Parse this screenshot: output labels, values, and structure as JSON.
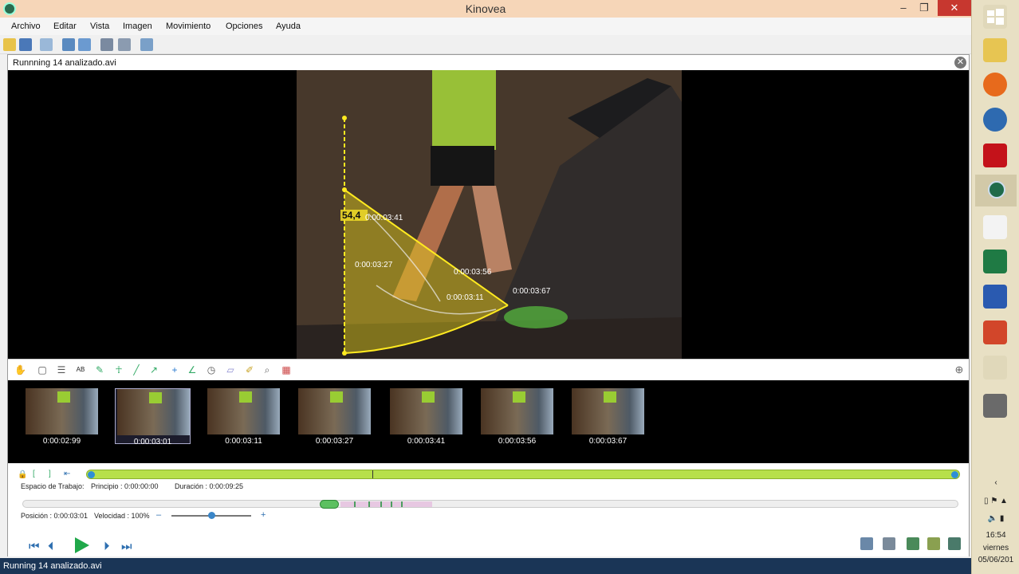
{
  "window": {
    "title": "Kinovea",
    "controls": {
      "minimize": "–",
      "maximize": "❐",
      "close": "✕"
    }
  },
  "menu": [
    "Archivo",
    "Editar",
    "Vista",
    "Imagen",
    "Movimiento",
    "Opciones",
    "Ayuda"
  ],
  "toolbar_icons": [
    "open-folder-icon",
    "save-icon",
    "layout-icon",
    "single-screen-icon",
    "dual-screen-icon",
    "capture-icon",
    "capture-dual-icon",
    "export-icon"
  ],
  "screen": {
    "title": "Runnning 14 analizado.avi",
    "close_label": "✕",
    "overlay": {
      "angle": "54,4",
      "trajectory_labels": [
        "0:00:03:41",
        "0:00:03:27",
        "0:00:03:56",
        "0:00:03:11",
        "0:00:03:67"
      ]
    }
  },
  "drawing_tools": [
    "hand-icon",
    "key-image-icon",
    "comment-icon",
    "label-icon",
    "pencil-icon",
    "human-model-icon",
    "line-icon",
    "arrow-icon",
    "cross-marker-icon",
    "angle-icon",
    "chrono-icon",
    "grid-icon",
    "magnifier-icon",
    "zoom-icon",
    "color-picker-icon"
  ],
  "thumbnails": [
    {
      "time": "0:00:02:99",
      "selected": false
    },
    {
      "time": "0:00:03:01",
      "selected": true
    },
    {
      "time": "0:00:03:11",
      "selected": false
    },
    {
      "time": "0:00:03:27",
      "selected": false
    },
    {
      "time": "0:00:03:41",
      "selected": false
    },
    {
      "time": "0:00:03:56",
      "selected": false
    },
    {
      "time": "0:00:03:67",
      "selected": false
    }
  ],
  "workspace": {
    "label": "Espacio de Trabajo:",
    "start": "Principio : 0:00:00:00",
    "duration": "Duración : 0:00:09:25"
  },
  "position": {
    "label": "Posición : 0:00:03:01",
    "speed": "Velocidad : 100%",
    "minus": "–",
    "plus": "+",
    "speed_level": 0.5
  },
  "playback": {
    "first": "⏮",
    "prev": "⏴",
    "next": "⏵",
    "last": "⏭"
  },
  "statusbar": {
    "text": "Running 14 analizado.avi"
  },
  "taskbar": {
    "time": "16:54",
    "day": "viernes",
    "date": "05/06/201"
  },
  "colors": {
    "accent": "#b7e04a",
    "overlay": "#f0e030",
    "close": "#c7372f",
    "status": "#1a3556"
  }
}
